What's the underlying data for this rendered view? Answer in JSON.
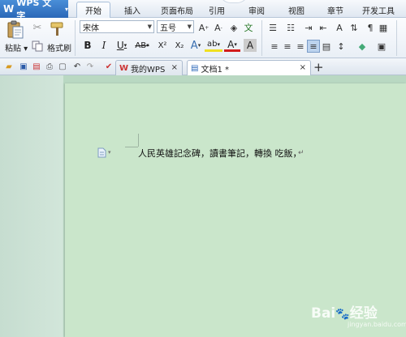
{
  "app": {
    "name": "WPS 文字"
  },
  "menu": {
    "tabs": [
      {
        "label": "开始",
        "active": true
      },
      {
        "label": "插入",
        "active": false
      },
      {
        "label": "页面布局",
        "active": false
      },
      {
        "label": "引用",
        "active": false
      },
      {
        "label": "审阅",
        "active": false
      },
      {
        "label": "视图",
        "active": false
      },
      {
        "label": "章节",
        "active": false
      },
      {
        "label": "开发工具",
        "active": false
      }
    ]
  },
  "ribbon": {
    "paste_label": "粘贴",
    "format_painter_label": "格式刷",
    "font_name": "宋体",
    "font_size": "五号",
    "bold": "B",
    "italic": "I",
    "underline": "U",
    "strike": "AB",
    "superscript": "X²",
    "subscript": "X₂",
    "font_color": "A",
    "effects": "A",
    "highlight": "ab",
    "shade": "A",
    "char_border": "A",
    "phonetic": "文",
    "icons": [
      "paste-icon",
      "cut-icon",
      "copy-icon",
      "format-painter-icon",
      "bullets-icon",
      "numbering-icon",
      "indent-icon",
      "sort-icon",
      "table-icon",
      "align-left-icon",
      "align-center-icon",
      "align-right-icon",
      "justify-icon",
      "distributed-icon",
      "line-spacing-icon",
      "fill-color-icon",
      "borders-icon"
    ]
  },
  "quickbar": {
    "icons": [
      "open-icon",
      "save-icon",
      "pdf-icon",
      "print-icon",
      "preview-icon",
      "undo-icon",
      "redo-icon"
    ]
  },
  "doctabs": [
    {
      "label": "我的WPS",
      "active": false
    },
    {
      "label": "文档1 *",
      "active": true
    }
  ],
  "document": {
    "text": "人民英雄記念碑，讀書筆記，轉換 吃飯，",
    "paragraph_mark": "↵"
  },
  "watermark": {
    "text": "Bai",
    "text2": "经验",
    "url": "jingyan.baidu.com"
  },
  "colors": {
    "accent": "#2a67b8",
    "page": "#cae6cb",
    "workspace": "#b9d8c2",
    "underline_red": "#d21c1c"
  }
}
